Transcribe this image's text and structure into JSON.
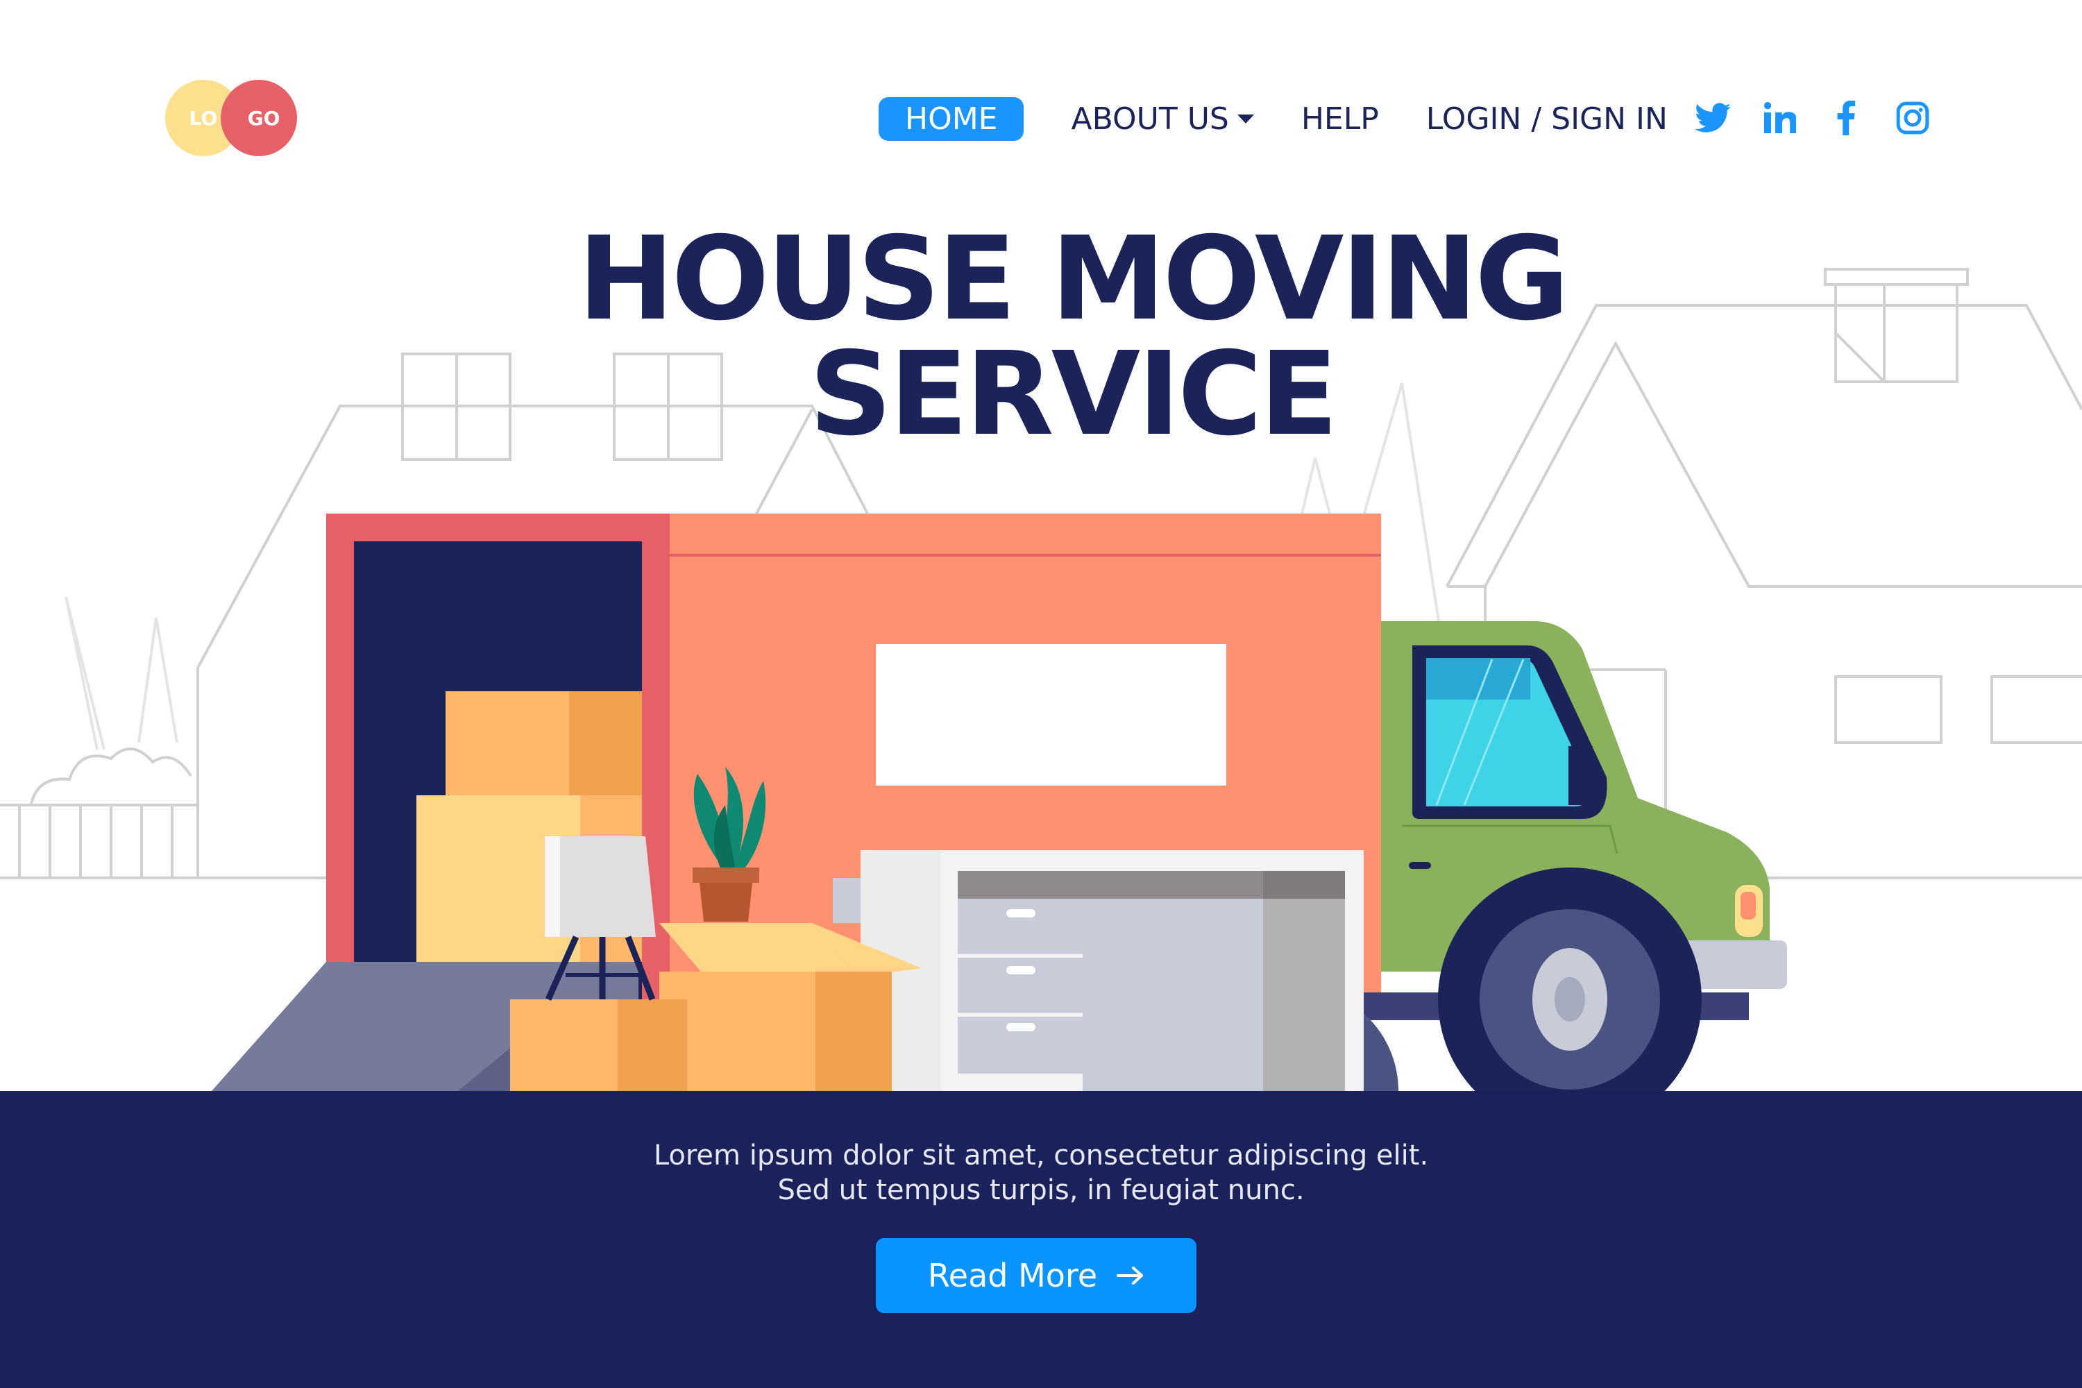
{
  "logo": {
    "left": "LO",
    "right": "GO"
  },
  "nav": {
    "home": "HOME",
    "about": "ABOUT US",
    "help": "HELP",
    "login": "LOGIN / SIGN IN"
  },
  "social": [
    "twitter-icon",
    "linkedin-icon",
    "facebook-icon",
    "instagram-icon"
  ],
  "hero": {
    "title_line1": "HOUSE MOVING",
    "title_line2": "SERVICE"
  },
  "description": {
    "line1": "Lorem ipsum dolor sit amet, consectetur adipiscing elit.",
    "line2": "Sed ut tempus turpis, in feugiat nunc."
  },
  "cta": {
    "label": "Read More"
  },
  "colors": {
    "navy": "#1b2358",
    "accent_blue": "#1a94ff",
    "truck_body": "#ff9170",
    "truck_door": "#e56067",
    "cab_green": "#8bb15c",
    "band": "#1b215a"
  }
}
